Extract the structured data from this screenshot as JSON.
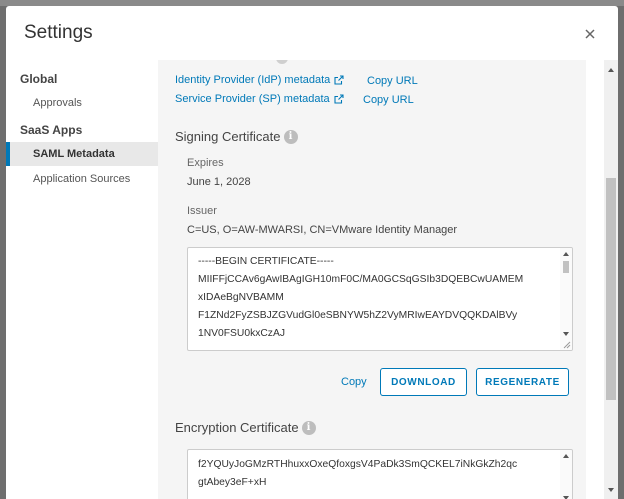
{
  "modal": {
    "title": "Settings",
    "close_icon": "close-icon"
  },
  "sidebar": {
    "groups": [
      {
        "label": "Global",
        "items": [
          {
            "label": "Approvals"
          }
        ]
      },
      {
        "label": "SaaS Apps",
        "items": [
          {
            "label": "SAML Metadata",
            "active": true
          },
          {
            "label": "Application Sources"
          }
        ]
      }
    ]
  },
  "metadata_links": {
    "idp": {
      "label": "Identity Provider (IdP) metadata",
      "icon": "external-link-icon",
      "copy": "Copy URL"
    },
    "sp": {
      "label": "Service Provider (SP) metadata",
      "icon": "external-link-icon",
      "copy": "Copy URL"
    }
  },
  "signing_certificate": {
    "title": "Signing Certificate",
    "info_icon": "info-icon",
    "expires_label": "Expires",
    "expires_value": "June 1, 2028",
    "issuer_label": "Issuer",
    "issuer_value": "C=US, O=AW-MWARSI, CN=VMware Identity Manager",
    "cert_lines": [
      "-----BEGIN CERTIFICATE-----",
      "MIIFFjCCAv6gAwIBAgIGH10mF0C/MA0GCSqGSIb3DQEBCwUAMEM",
      "xIDAeBgNVBAMM",
      "F1ZNd2FyZSBJZGVudGl0eSBNYW5hZ2VyMRIwEAYDVQQKDAlBVy",
      "1NV0FSU0kxCzAJ"
    ],
    "actions": {
      "copy": "Copy",
      "download": "DOWNLOAD",
      "regenerate": "REGENERATE"
    }
  },
  "encryption_certificate": {
    "title": "Encryption Certificate",
    "info_icon": "info-icon",
    "cert_lines": [
      "f2YQUyJoGMzRTHhuxxOxeQfoxgsV4PaDk3SmQCKEL7iNkGkZh2qc",
      "gtAbey3eF+xH"
    ]
  },
  "colors": {
    "accent": "#0079b8",
    "backdrop": "#6e6e6e",
    "content_bg": "#f5f5f5"
  }
}
